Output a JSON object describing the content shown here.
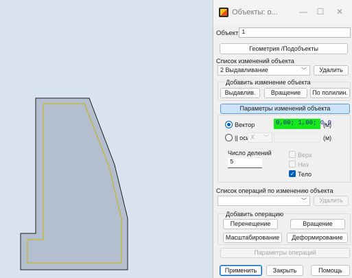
{
  "window": {
    "title": "Объекты: о...",
    "minimize_icon": "minimize-icon",
    "maximize_icon": "maximize-icon",
    "close_icon": "close-icon"
  },
  "object": {
    "label": "Объект:",
    "value": "1"
  },
  "geometry_button": "Геометрия /Подобъекты",
  "changes": {
    "label": "Список изменений объекта",
    "selected": "2 Выдавливание",
    "delete_button": "Удалить"
  },
  "add_change": {
    "label": "Добавить изменение объекта",
    "extrude_button": "Выдавлив.",
    "rotate_button": "Вращение",
    "polyline_button": "По полилин."
  },
  "params_button": "Параметры изменений объекта",
  "vector": {
    "label": "Вектор",
    "value": "0,00; 1,00; 0,0",
    "unit": "(м)",
    "axis_label": "|| оси",
    "axis_value": "X",
    "axis_unit": "(м)"
  },
  "divisions": {
    "label": "Число делений",
    "value": "5"
  },
  "checks": {
    "top": "Верх",
    "bottom": "Низ",
    "body": "Тело"
  },
  "operations": {
    "label": "Список операций по изменению объекта",
    "delete_button": "Удалить"
  },
  "add_operation": {
    "label": "Добавить операцию",
    "move_button": "Перенещение",
    "rotate_button": "Вращение",
    "scale_button": "Масштабирование",
    "deform_button": "Деформирование"
  },
  "op_params_button": "Параметры операций",
  "footer": {
    "apply_button": "Применить",
    "close_button": "Закрыть",
    "help_button": "Помощь"
  },
  "colors": {
    "viewport_bg": "#d9e3ef",
    "shape_fill": "#b3bfcf",
    "shape_stroke": "#1c1c1c",
    "inner_line": "#c9b400",
    "accent": "#005fb8",
    "vector_bg": "#14e81a"
  }
}
